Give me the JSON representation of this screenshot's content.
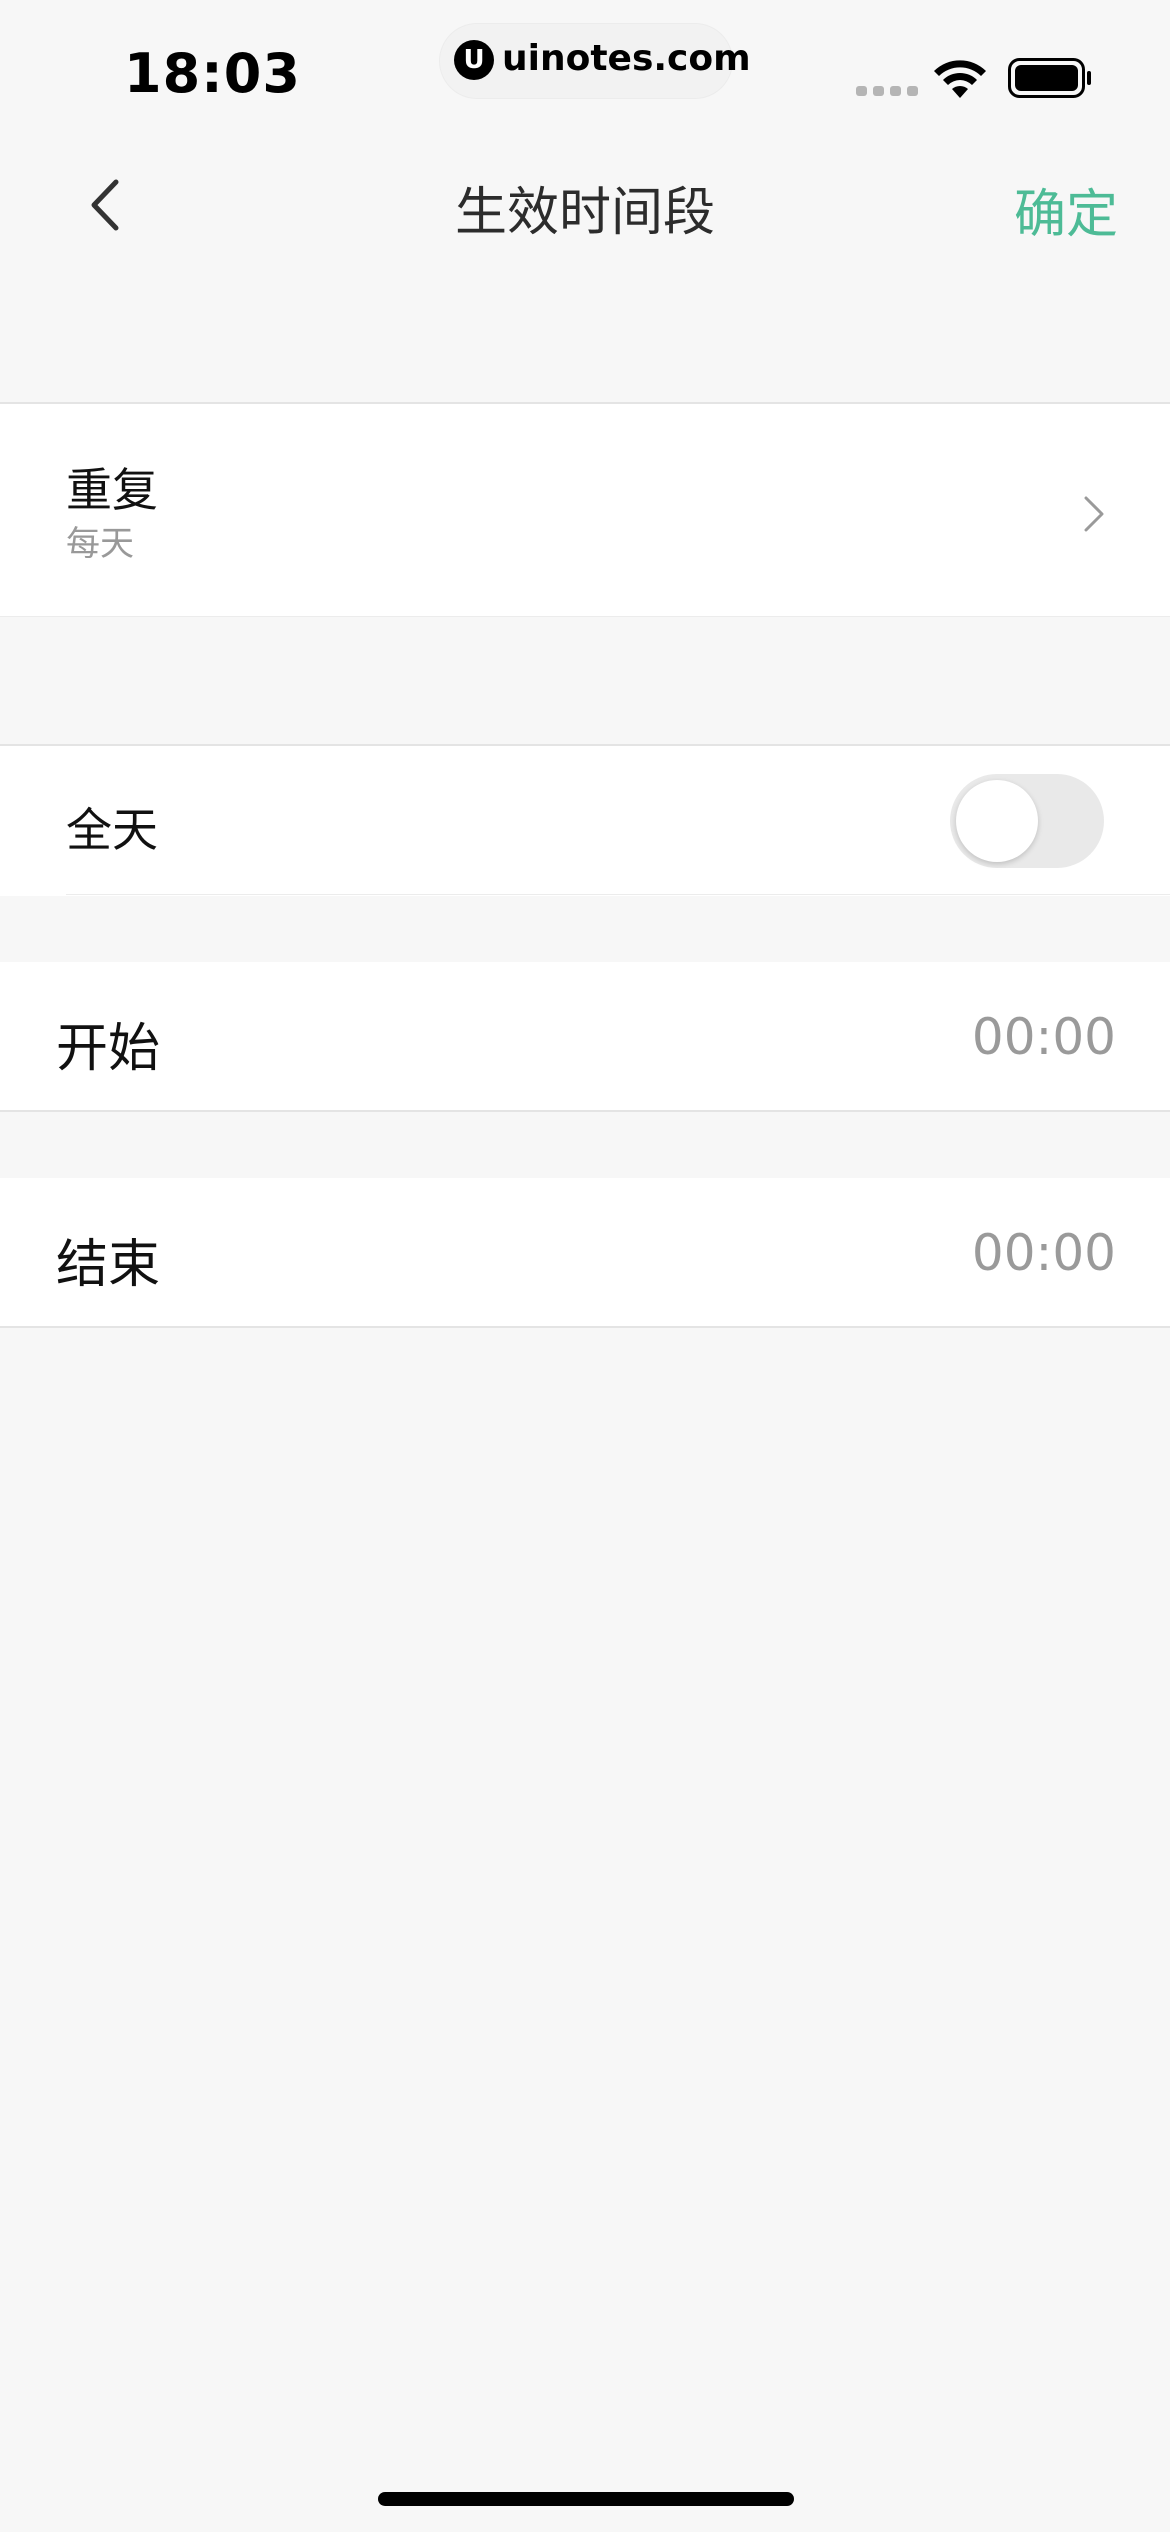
{
  "status_bar": {
    "time": "18:03",
    "url": "uinotes.com",
    "logo_glyph": "U"
  },
  "nav": {
    "back_icon": "chevron-left-icon",
    "title": "生效时间段",
    "confirm_label": "确定",
    "accent_color": "#4dbb96"
  },
  "repeat": {
    "label": "重复",
    "value": "每天",
    "chevron_icon": "chevron-right-icon"
  },
  "all_day": {
    "label": "全天",
    "enabled": false
  },
  "start": {
    "label": "开始",
    "value": "00:00"
  },
  "end": {
    "label": "结束",
    "value": "00:00"
  }
}
